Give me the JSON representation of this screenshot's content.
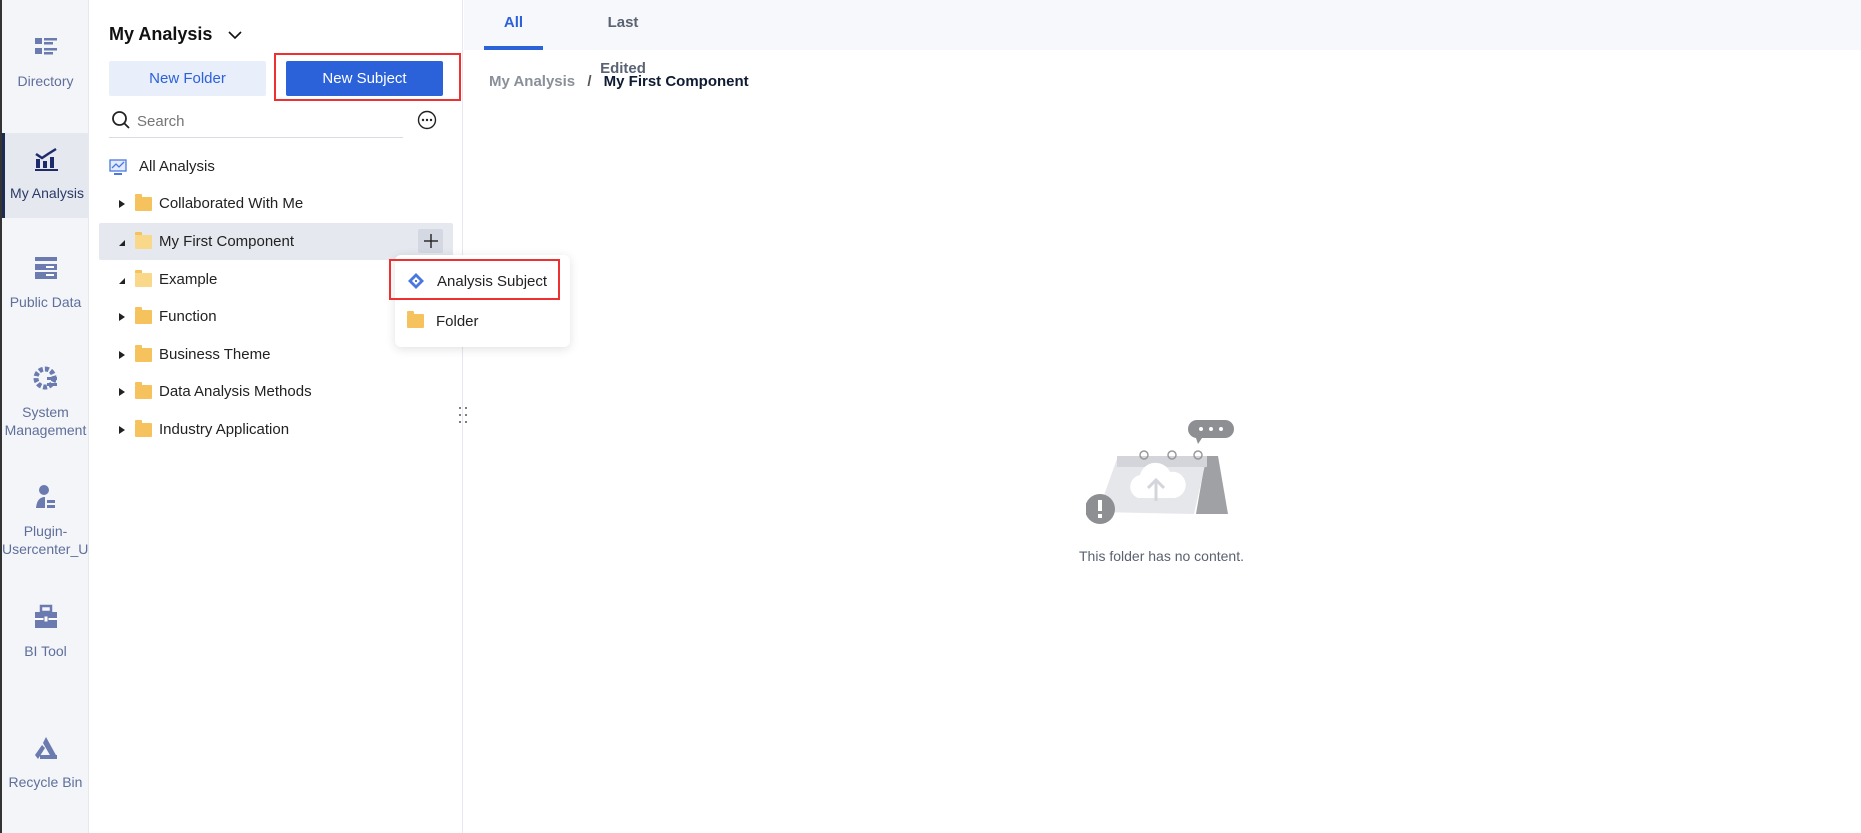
{
  "sidebar": {
    "items": [
      {
        "label": "Directory",
        "icon": "directory-icon"
      },
      {
        "label": "My Analysis",
        "icon": "analysis-chart-icon",
        "active": true
      },
      {
        "label": "Public Data",
        "icon": "public-data-icon"
      },
      {
        "label": "System Management",
        "icon": "gear-icon"
      },
      {
        "label": "Plugin-Usercenter_Use...",
        "icon": "user-icon"
      },
      {
        "label": "BI Tool",
        "icon": "toolbox-icon"
      },
      {
        "label": "Recycle Bin",
        "icon": "recycle-icon"
      }
    ]
  },
  "panel": {
    "title": "My Analysis",
    "new_folder": "New Folder",
    "new_subject": "New Subject",
    "search_placeholder": "Search",
    "tree": {
      "root": "All Analysis",
      "items": [
        {
          "label": "Collaborated With Me",
          "expanded": false
        },
        {
          "label": "My First Component",
          "expanded": true,
          "selected": true
        },
        {
          "label": "Example",
          "expanded": true
        },
        {
          "label": "Function",
          "expanded": false
        },
        {
          "label": "Business Theme",
          "expanded": false
        },
        {
          "label": "Data Analysis Methods",
          "expanded": false
        },
        {
          "label": "Industry Application",
          "expanded": false
        }
      ]
    },
    "add_menu": {
      "analysis_subject": "Analysis Subject",
      "folder": "Folder"
    }
  },
  "main": {
    "tabs": [
      "All",
      "Last Edited"
    ],
    "active_tab": "All",
    "breadcrumb": {
      "parent": "My Analysis",
      "separator": "/",
      "current": "My First Component"
    },
    "empty_text": "This folder has no content."
  },
  "colors": {
    "accent": "#2b61d9",
    "highlight": "#ee3030",
    "folder": "#f6c25e"
  }
}
